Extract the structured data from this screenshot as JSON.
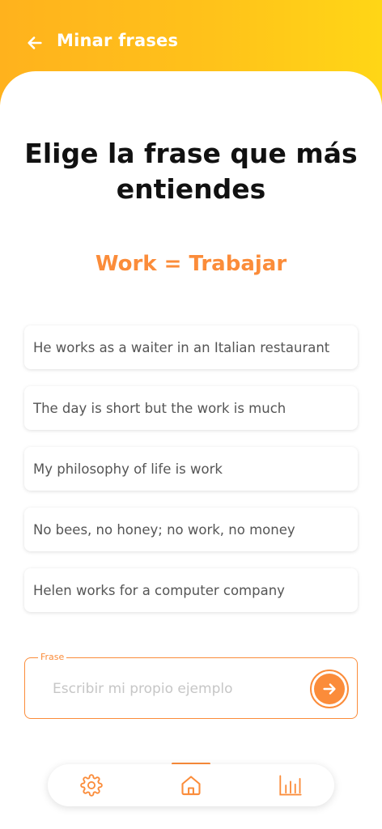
{
  "colors": {
    "header_gradient_start": "#ffb21d",
    "header_gradient_end": "#ffd616",
    "accent": "#fb8c3a",
    "text_dark": "#111111",
    "text_muted": "#555555",
    "placeholder": "#c6c6c6"
  },
  "header": {
    "back_icon": "arrow-left-icon",
    "title": "Minar frases"
  },
  "main": {
    "title": "Elige la frase que más entiendes",
    "word_pair": "Work = Trabajar"
  },
  "phrases": [
    "He works as a waiter in an Italian restaurant",
    "The day is short but the work is much",
    "My philosophy of life is work",
    "No bees, no honey; no work, no money",
    "Helen works for a computer company"
  ],
  "input": {
    "legend": "Frase",
    "value": "",
    "placeholder": "Escribir mi propio ejemplo",
    "send_icon": "arrow-right-circle-icon"
  },
  "nav": {
    "items": [
      {
        "icon": "gear-icon",
        "active": false
      },
      {
        "icon": "home-icon",
        "active": true
      },
      {
        "icon": "bar-chart-icon",
        "active": false
      }
    ]
  }
}
